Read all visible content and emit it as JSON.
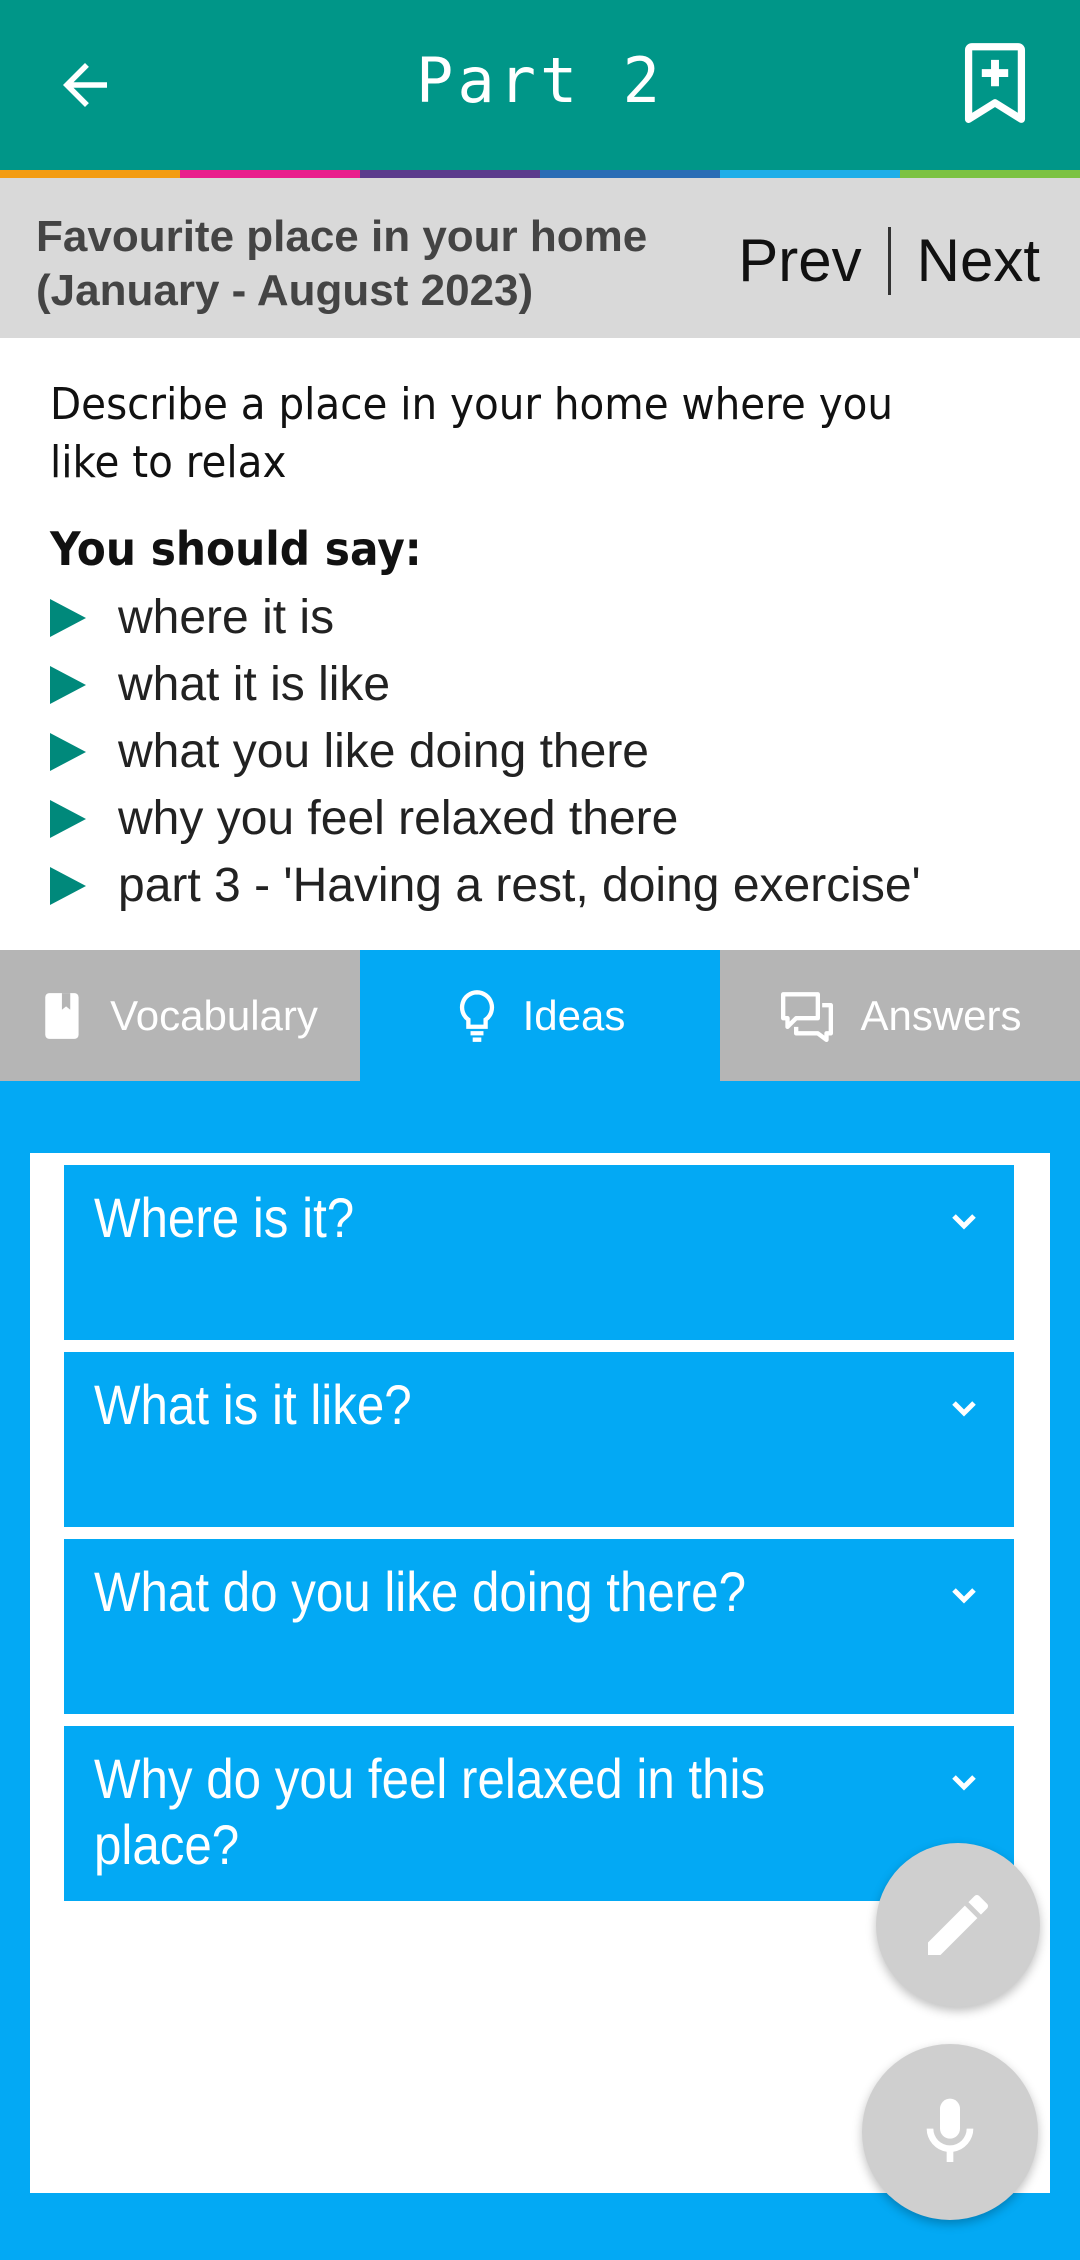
{
  "appbar": {
    "title": "Part 2",
    "back_icon": "arrow-left-icon",
    "bookmark_icon": "bookmark-add-icon",
    "color": "#009688"
  },
  "stripe_colors": [
    "#f39c12",
    "#e91e8c",
    "#5b3b8c",
    "#2a6db5",
    "#1eaee8",
    "#7cc242"
  ],
  "topic": {
    "name_line1": "Favourite place in your home",
    "name_line2": "(January - August 2023)",
    "prev_label": "Prev",
    "next_label": "Next"
  },
  "cue_card": {
    "description": "Describe a place in your home where you like to relax",
    "should_say": "You should say:",
    "points": [
      "where it is",
      "what it is like",
      "what you like doing there",
      "why you feel relaxed there",
      "part 3 - 'Having a rest, doing exercise'"
    ]
  },
  "tabs": [
    {
      "label": "Vocabulary",
      "icon": "book-icon",
      "active": false
    },
    {
      "label": "Ideas",
      "icon": "lightbulb-icon",
      "active": true
    },
    {
      "label": "Answers",
      "icon": "chat-icon",
      "active": false
    }
  ],
  "ideas": [
    {
      "question": "Where is it?"
    },
    {
      "question": "What is it like?"
    },
    {
      "question": "What do you like doing there?"
    },
    {
      "question": "Why do you feel relaxed in this place?"
    }
  ],
  "fabs": {
    "edit_icon": "pencil-icon",
    "mic_icon": "microphone-icon"
  },
  "colors": {
    "accent": "#03a9f4",
    "tab_inactive": "#b5b5b5",
    "bullet": "#00897b",
    "header_band": "#d9d9d9"
  }
}
